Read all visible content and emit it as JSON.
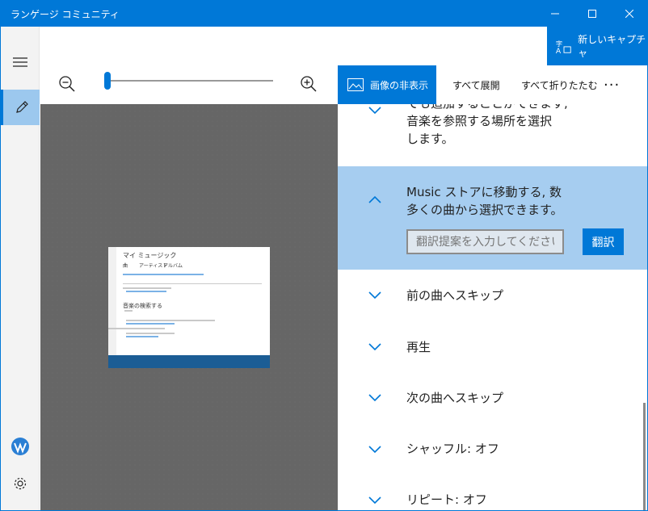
{
  "window": {
    "title": "ランゲージ コミュニティ"
  },
  "toolbar": {
    "new_capture": "新しいキャプチャ",
    "zoom_level": 0,
    "hide_image": "画像の非表示",
    "expand_all": "すべて展開",
    "collapse_all": "すべて折りたたむ",
    "more": "···"
  },
  "thumbnail": {
    "title": "マイ ミュージック",
    "tabs": [
      "曲",
      "アーティスト",
      "アルバム"
    ],
    "section": "音楽の検索する"
  },
  "list": {
    "items": [
      {
        "label_lines": [
          "でも追加することができます,",
          "音楽を参照する場所を選択",
          "します。"
        ],
        "expanded": false
      },
      {
        "label_lines": [
          "Music ストアに移動する, 数",
          "多くの曲から選択できます。"
        ],
        "expanded": true,
        "suggestion_placeholder": "翻訳提案を入力してください",
        "translate_button": "翻訳"
      },
      {
        "label_lines": [
          "前の曲へスキップ"
        ],
        "expanded": false
      },
      {
        "label_lines": [
          "再生"
        ],
        "expanded": false
      },
      {
        "label_lines": [
          "次の曲へスキップ"
        ],
        "expanded": false
      },
      {
        "label_lines": [
          "シャッフル: オフ"
        ],
        "expanded": false
      },
      {
        "label_lines": [
          "リピート: オフ"
        ],
        "expanded": false
      }
    ]
  },
  "colors": {
    "accent": "#0078d7",
    "selected": "#a6cdf0",
    "canvas": "#666666"
  }
}
